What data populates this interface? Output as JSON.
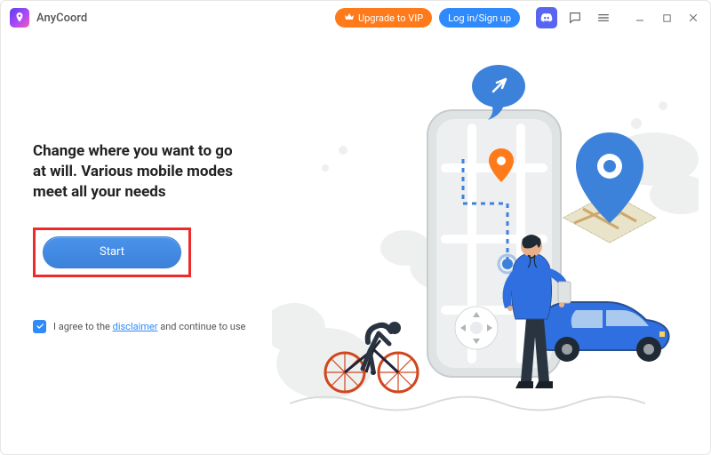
{
  "app": {
    "title": "AnyCoord"
  },
  "titlebar": {
    "upgrade_label": "Upgrade to VIP",
    "login_label": "Log in/Sign up"
  },
  "main": {
    "headline": "Change where you want to go at will. Various mobile modes meet all your needs",
    "start_label": "Start",
    "agree_prefix": "I agree to the ",
    "disclaimer_link": "disclaimer",
    "agree_suffix": " and continue to use"
  },
  "colors": {
    "accent_blue": "#2f8afc",
    "accent_orange": "#ff7a1a",
    "highlight_red": "#ef2a2a"
  }
}
